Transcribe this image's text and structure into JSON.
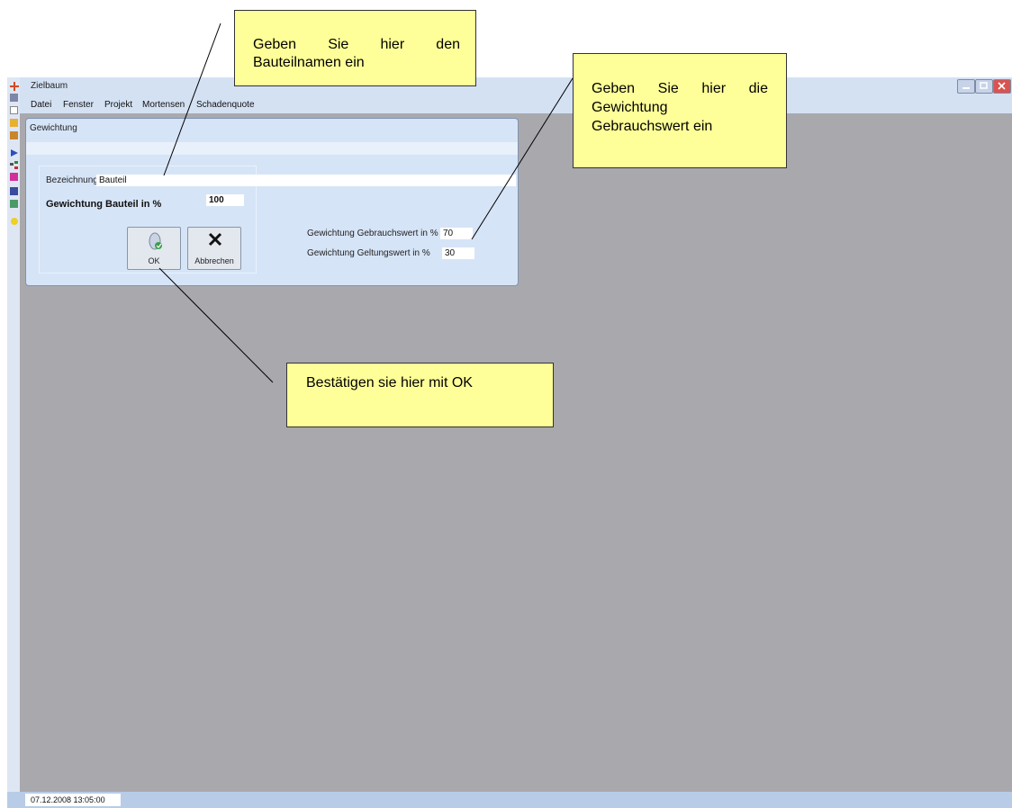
{
  "window": {
    "title": "Zielbaum",
    "controls": [
      "minimize",
      "restore",
      "close"
    ]
  },
  "menu": [
    "Datei",
    "Fenster",
    "Projekt",
    "Mortensen",
    "Schadenquote"
  ],
  "sidebar": {
    "icons": [
      "app-icon",
      "document-icon",
      "page-icon",
      "folder-icon",
      "copy-icon",
      "arrow-icon",
      "tree-icon",
      "grid-icon",
      "print-icon",
      "tools-icon",
      "help-icon"
    ]
  },
  "dialog": {
    "title": "Gewichtung",
    "bezeichnung_label": "Bezeichnung",
    "bezeichnung_value": "Bauteil",
    "gewichtung_bauteil_label": "Gewichtung Bauteil in %",
    "gewichtung_bauteil_value": "100",
    "ok_label": "OK",
    "cancel_label": "Abbrechen",
    "gebrauchswert_label": "Gewichtung Gebrauchswert in %",
    "gebrauchswert_value": "70",
    "geltungswert_label": "Gewichtung Geltungswert in %",
    "geltungswert_value": "30"
  },
  "status": {
    "datetime": "07.12.2008 13:05:00"
  },
  "callouts": {
    "bauteilname": "Geben Sie hier den Bauteilnamen ein",
    "gebrauchswert": "Geben Sie hier die Gewichtung Gebrauchswert ein",
    "ok": "Bestätigen sie hier mit OK"
  },
  "colors": {
    "workspace": "#a9a9ad",
    "titlebar": "#d3e1f3",
    "dialog": "#d6e4f7",
    "callout": "#ffff99",
    "close_button": "#d9534f"
  }
}
